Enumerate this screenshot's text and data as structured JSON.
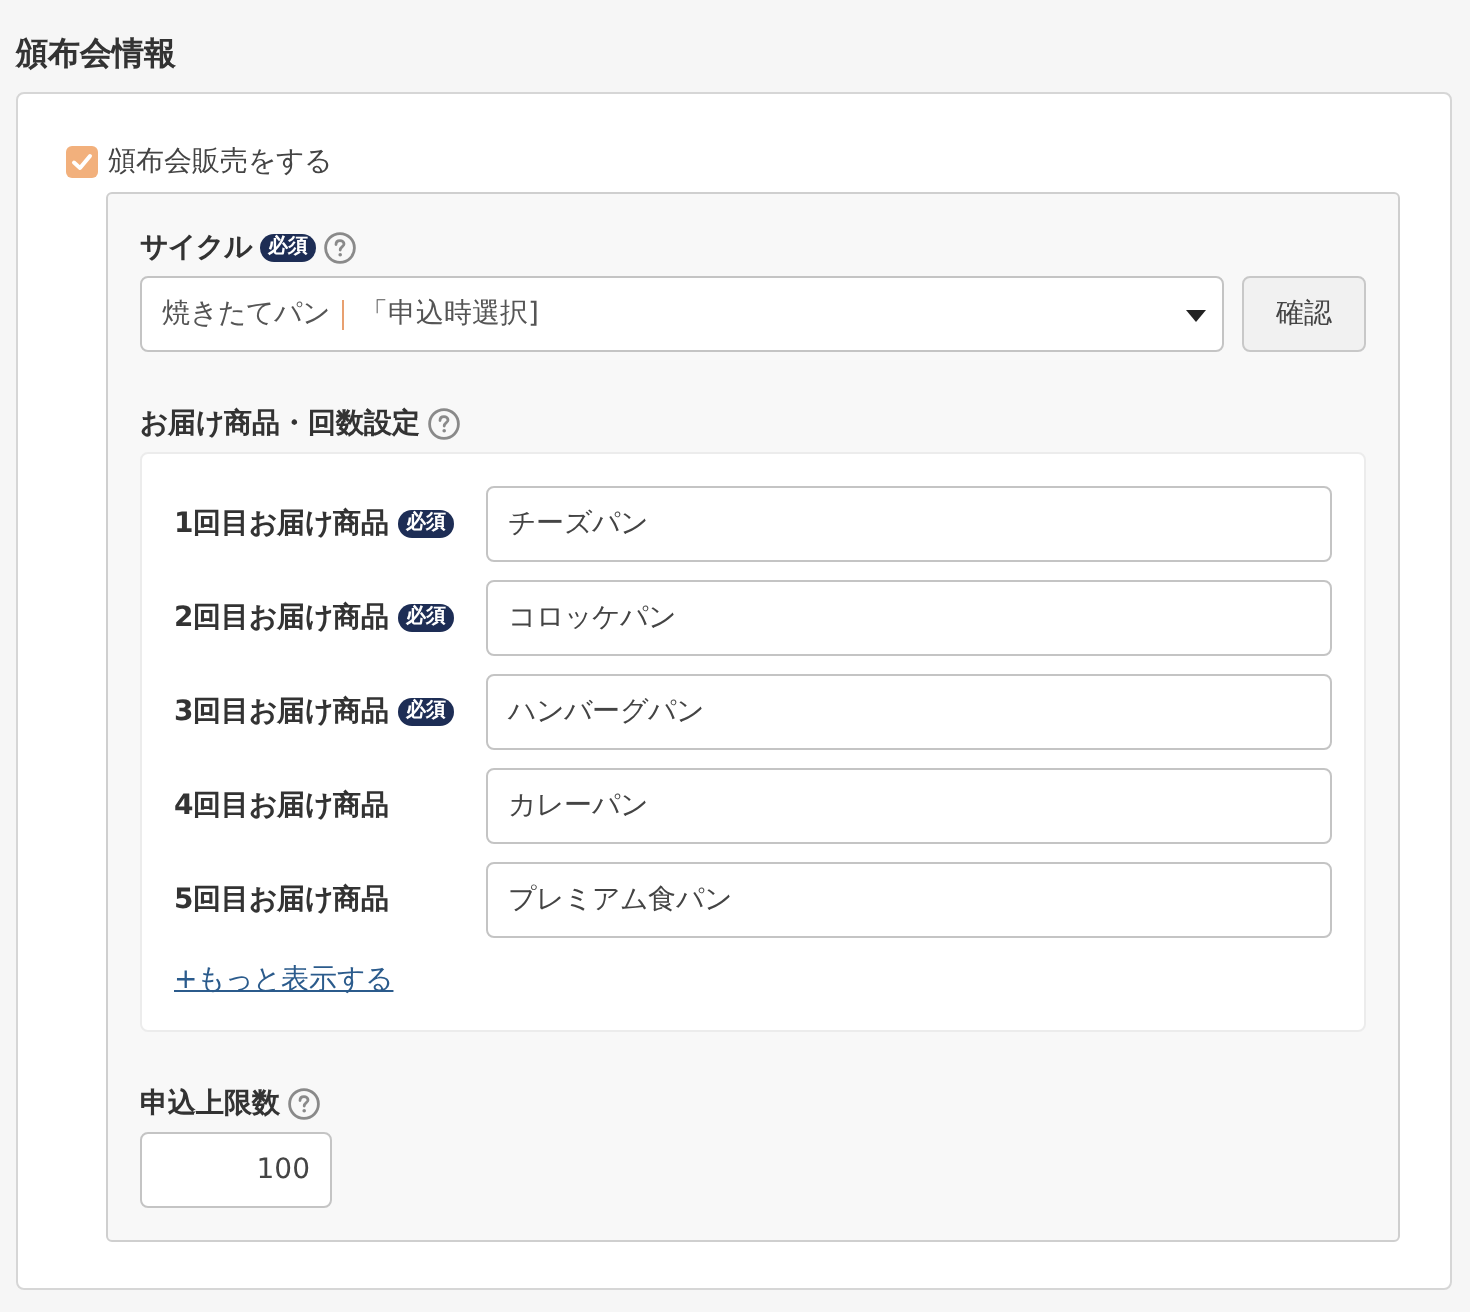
{
  "section_title": "頒布会情報",
  "subscription_checkbox": {
    "label": "頒布会販売をする",
    "checked": true
  },
  "cycle": {
    "label": "サイクル",
    "required_badge": "必須",
    "product": "焼きたてパン",
    "timing": "「申込時選択]",
    "confirm_button": "確認"
  },
  "delivery_items": {
    "label": "お届け商品・回数設定",
    "rows": [
      {
        "label": "1回目お届け商品",
        "required_badge": "必須",
        "value": "チーズパン"
      },
      {
        "label": "2回目お届け商品",
        "required_badge": "必須",
        "value": "コロッケパン"
      },
      {
        "label": "3回目お届け商品",
        "required_badge": "必須",
        "value": "ハンバーグパン"
      },
      {
        "label": "4回目お届け商品",
        "value": "カレーパン"
      },
      {
        "label": "5回目お届け商品",
        "value": "プレミアム食パン"
      }
    ],
    "more_link": "+もっと表示する"
  },
  "max_applications": {
    "label": "申込上限数",
    "value": "100"
  }
}
